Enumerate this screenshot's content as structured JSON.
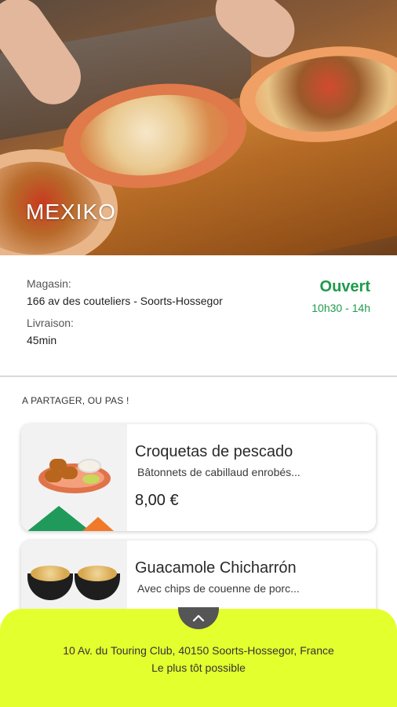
{
  "restaurant": {
    "name": "MEXIKO"
  },
  "store_info": {
    "store_label": "Magasin:",
    "store_address": "166 av des couteliers - Soorts-Hossegor",
    "delivery_label": "Livraison:",
    "delivery_time": "45min",
    "status": "Ouvert",
    "hours": "10h30 - 14h",
    "status_color": "#1f9a4c"
  },
  "menu": {
    "section_title": "A PARTAGER, OU PAS !",
    "items": [
      {
        "name": "Croquetas de pescado",
        "description": "Bâtonnets de cabillaud enrobés...",
        "price": "8,00 €"
      },
      {
        "name": "Guacamole Chicharrón",
        "description": "Avec chips de couenne de porc...",
        "price": ""
      }
    ]
  },
  "bottom_sheet": {
    "address": "10 Av. du Touring Club, 40150 Soorts-Hossegor, France",
    "time": "Le plus tôt possible",
    "handle_icon": "chevron-up-icon",
    "background_color": "#e4ff2e"
  }
}
